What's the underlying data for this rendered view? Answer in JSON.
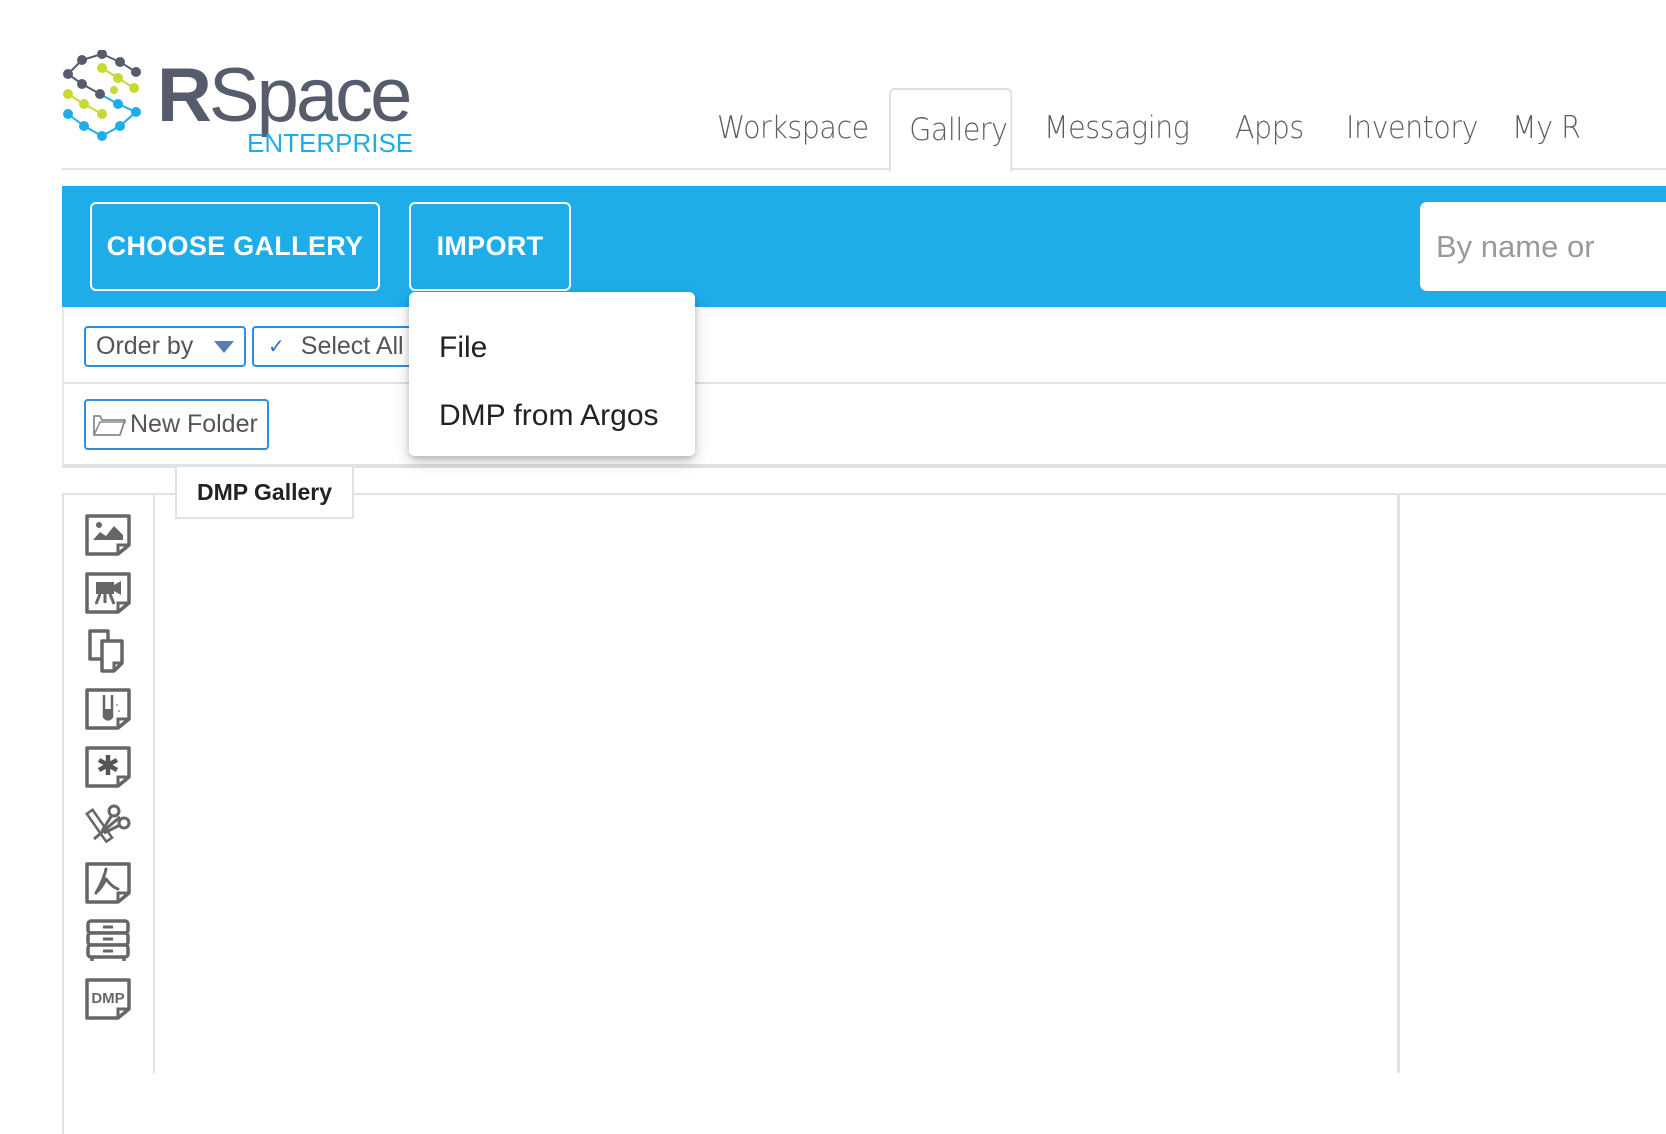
{
  "brand": {
    "logo_bold": "R",
    "logo_rest": "Space",
    "edition": "ENTERPRISE",
    "colors": {
      "dark": "#575c6c",
      "lime": "#c8d932",
      "blue": "#1fade9"
    }
  },
  "nav": {
    "tabs": [
      {
        "label": "Workspace",
        "active": false
      },
      {
        "label": "Gallery",
        "active": true
      },
      {
        "label": "Messaging",
        "active": false
      },
      {
        "label": "Apps",
        "active": false
      },
      {
        "label": "Inventory",
        "active": false
      },
      {
        "label": "My R",
        "active": false
      }
    ]
  },
  "toolbar": {
    "choose_gallery_label": "CHOOSE GALLERY",
    "import_label": "IMPORT",
    "search_placeholder": "By name or",
    "accent_color": "#1fade9"
  },
  "import_menu": {
    "items": [
      {
        "label": "File"
      },
      {
        "label": "DMP from Argos"
      }
    ]
  },
  "filters": {
    "order_by_label": "Order by",
    "select_all_label": "Select All"
  },
  "actions": {
    "new_folder_label": "New Folder"
  },
  "gallery": {
    "current_tab": "DMP Gallery",
    "sidebar_icons": [
      {
        "name": "images-icon"
      },
      {
        "name": "videos-icon"
      },
      {
        "name": "documents-icon"
      },
      {
        "name": "chemistry-icon"
      },
      {
        "name": "miscellaneous-icon"
      },
      {
        "name": "snippets-icon"
      },
      {
        "name": "pdf-export-icon"
      },
      {
        "name": "filestores-icon"
      },
      {
        "name": "dmp-icon",
        "text": "DMP"
      }
    ]
  }
}
